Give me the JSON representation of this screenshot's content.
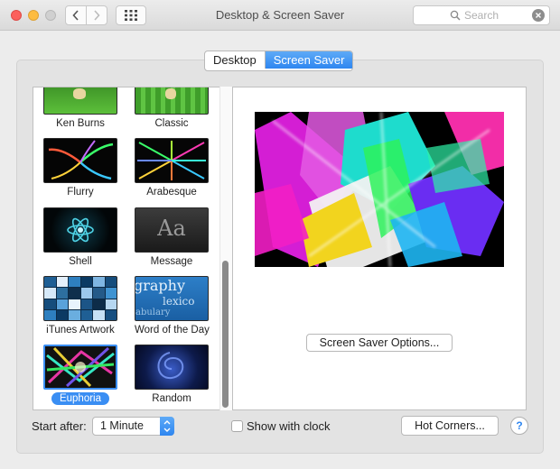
{
  "window": {
    "title": "Desktop & Screen Saver",
    "search_placeholder": "Search"
  },
  "tabs": [
    {
      "label": "Desktop",
      "selected": false
    },
    {
      "label": "Screen Saver",
      "selected": true
    }
  ],
  "screensavers": [
    {
      "name": "Ken Burns"
    },
    {
      "name": "Classic"
    },
    {
      "name": "Flurry"
    },
    {
      "name": "Arabesque"
    },
    {
      "name": "Shell"
    },
    {
      "name": "Message",
      "thumb_text": "Aa"
    },
    {
      "name": "iTunes Artwork"
    },
    {
      "name": "Word of the Day",
      "thumb_words": [
        "graphy",
        "lexico",
        "abulary"
      ]
    },
    {
      "name": "Euphoria",
      "selected": true
    },
    {
      "name": "Random"
    }
  ],
  "options_button": "Screen Saver Options...",
  "start_after": {
    "label": "Start after:",
    "value": "1 Minute"
  },
  "show_clock": {
    "label": "Show with clock",
    "checked": false
  },
  "hot_corners_button": "Hot Corners...",
  "help_button": "?",
  "colors": {
    "accent": "#2e86f0",
    "selection": "#3a8ef3"
  }
}
